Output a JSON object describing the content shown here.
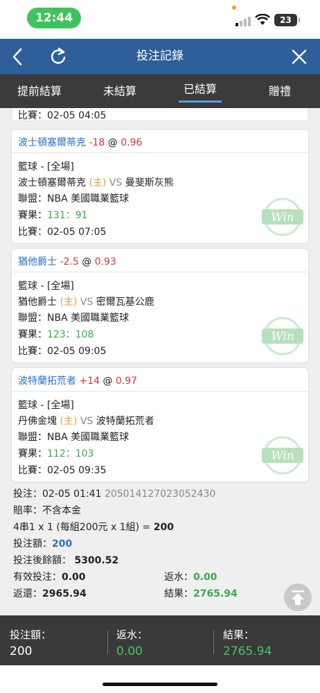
{
  "status_bar": {
    "time": "12:44",
    "battery": "23"
  },
  "header": {
    "title": "投注記錄"
  },
  "tabs": [
    {
      "label": "提前結算"
    },
    {
      "label": "未結算"
    },
    {
      "label": "已結算"
    },
    {
      "label": "贈禮"
    }
  ],
  "partial_card": {
    "label": "比賽：",
    "value": "02-05 04:05"
  },
  "bets": [
    {
      "team": "波士頓塞爾蒂克",
      "handicap": "-18",
      "at": "@",
      "odds": "0.96",
      "sport": "籃球 - [全場]",
      "home": "波士頓塞爾蒂克",
      "home_tag": "(主)",
      "vs": "VS",
      "away": "曼斐斯灰熊",
      "league": "聯盟：NBA 美國職業籃球",
      "score_label": "賽果：",
      "score": "131：91",
      "time_label": "比賽：",
      "time": "02-05 07:05",
      "result_badge": "Win"
    },
    {
      "team": "猶他爵士",
      "handicap": "-2.5",
      "at": "@",
      "odds": "0.93",
      "sport": "籃球 - [全場]",
      "home": "猶他爵士",
      "home_tag": "(主)",
      "vs": "VS",
      "away": "密爾瓦基公鹿",
      "league": "聯盟：NBA 美國職業籃球",
      "score_label": "賽果：",
      "score": "123：108",
      "time_label": "比賽：",
      "time": "02-05 09:05",
      "result_badge": "Win"
    },
    {
      "team": "波特蘭拓荒者",
      "handicap": "+14",
      "at": "@",
      "odds": "0.97",
      "sport": "籃球 - [全場]",
      "home": "丹佛金塊",
      "home_tag": "(主)",
      "vs": "VS",
      "away": "波特蘭拓荒者",
      "league": "聯盟：NBA 美國職業籃球",
      "score_label": "賽果：",
      "score": "112：103",
      "time_label": "比賽：",
      "time": "02-05 09:35",
      "result_badge": "Win"
    }
  ],
  "summary": {
    "bet_time_label": "投注：",
    "bet_time": "02-05 01:41",
    "bet_id": "205014127023052430",
    "odds_type": "賠率：不含本金",
    "combo_text": "4串1 x 1 (每組200元 x 1組) =",
    "combo_total": "200",
    "stake_label": "投注額：",
    "stake": "200",
    "balance_label": "投注後餘額：",
    "balance": "5300.52",
    "valid_label": "有效投注：",
    "valid": "0.00",
    "rebate_label": "返水：",
    "rebate": "0.00",
    "return_label": "返還：",
    "return": "2965.94",
    "result_label": "結果：",
    "result": "2765.94"
  },
  "footer": {
    "stake_label": "投注額：",
    "stake": "200",
    "rebate_label": "返水：",
    "rebate": "0.00",
    "result_label": "結果：",
    "result": "2765.94"
  },
  "colors": {
    "header": "#2f5f9a",
    "tabs": "#3b3b3b",
    "win_green": "#3aa84a",
    "odds_red": "#dd3333",
    "team_blue": "#2a73c7"
  }
}
